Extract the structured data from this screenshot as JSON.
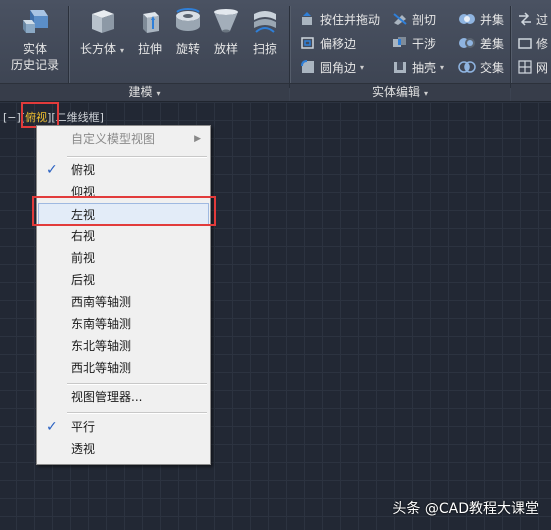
{
  "ribbon": {
    "history": {
      "line1": "实体",
      "line2": "历史记录"
    },
    "modeling_buttons": [
      "长方体",
      "拉伸",
      "旋转",
      "放样",
      "扫掠"
    ],
    "modeling_title": "建模",
    "solid_edit_rows": [
      [
        "按住并拖动",
        "剖切",
        "并集"
      ],
      [
        "偏移边",
        "干涉",
        "差集"
      ],
      [
        "圆角边",
        "抽壳",
        "交集"
      ]
    ],
    "solid_edit_title": "实体编辑",
    "right_cut": [
      "过",
      "修",
      "网"
    ]
  },
  "viewport": {
    "label_prefix": "[−][",
    "label_view": "俯视",
    "label_suffix": "][二维线框]"
  },
  "menu": {
    "header": "自定义模型视图",
    "views": [
      "俯视",
      "仰视",
      "左视",
      "右视",
      "前视",
      "后视",
      "西南等轴测",
      "东南等轴测",
      "东北等轴测",
      "西北等轴测"
    ],
    "checked_view": "俯视",
    "highlighted_view": "左视",
    "manager": "视图管理器...",
    "projections": [
      "平行",
      "透视"
    ],
    "checked_projection": "平行",
    "check_mark": "✓"
  },
  "watermark": "头条 @CAD教程大课堂",
  "colors": {
    "accent": "#f0c030",
    "highlight_border": "#e23b3b",
    "check": "#2b62c2"
  }
}
